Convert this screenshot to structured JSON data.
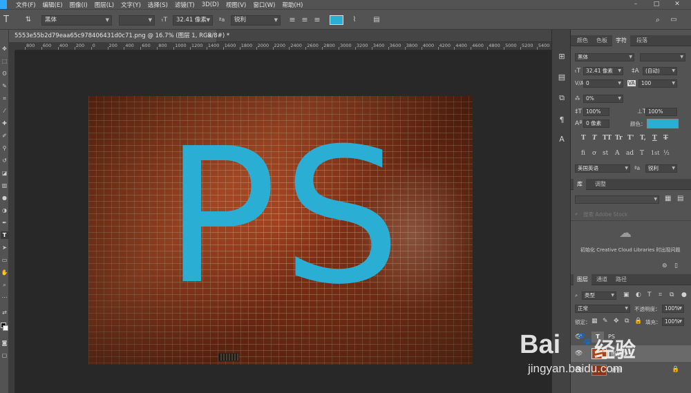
{
  "menu": {
    "items": [
      "文件(F)",
      "编辑(E)",
      "图像(I)",
      "图层(L)",
      "文字(Y)",
      "选择(S)",
      "滤镜(T)",
      "3D(D)",
      "视图(V)",
      "窗口(W)",
      "帮助(H)"
    ],
    "window_min": "–",
    "window_max": "□",
    "window_close": "✕"
  },
  "options": {
    "tool_glyph": "T",
    "font_family": "黑体",
    "font_style": "",
    "font_size": "32.41 像素",
    "aa_label": "ªa",
    "antialias": "锐利",
    "text_color": "#2aaed4"
  },
  "document": {
    "tab_title": "5553e55b2d79eaa65c978406431d0c71.png @ 16.7% (图层 1, RGB/8#) *",
    "tab_close": "×",
    "text_layer_content": "PS"
  },
  "ruler": {
    "labels": [
      "800",
      "600",
      "400",
      "200",
      "0",
      "200",
      "400",
      "600",
      "800",
      "1000",
      "1200",
      "1400",
      "1600",
      "1800",
      "2000",
      "2200",
      "2400",
      "2600",
      "2800",
      "3000",
      "3200",
      "3400",
      "3600",
      "3800",
      "4000",
      "4200",
      "4400",
      "4600",
      "4800",
      "5000",
      "5200",
      "5400"
    ]
  },
  "character_panel": {
    "tabs": [
      "颜色",
      "色板",
      "字符",
      "段落"
    ],
    "font_family": "黑体",
    "font_style": "",
    "font_size": "32.41 像素",
    "leading": "(自动)",
    "kerning": "0",
    "tracking": "100",
    "scale_percent": "0%",
    "vertical_scale": "100%",
    "horizontal_scale": "100%",
    "baseline_shift": "0 像素",
    "color_label": "颜色：",
    "color": "#2aaed4",
    "language": "美国英语",
    "aa_label": "ªa",
    "antialias": "锐利",
    "style_buttons": [
      "T",
      "T",
      "TT",
      "Tr",
      "T'",
      "T,",
      "T",
      "T"
    ],
    "opentype_buttons": [
      "fi",
      "ơ",
      "st",
      "A",
      "ad",
      "T",
      "1st",
      "½"
    ]
  },
  "library_panel": {
    "tabs": [
      "库",
      "调整"
    ],
    "search_placeholder": "搜索 Adobe Stock",
    "message": "初始化 Creative Cloud Libraries 时出现问题"
  },
  "layers_panel": {
    "tabs": [
      "图层",
      "通道",
      "路径"
    ],
    "filter_kind": "类型",
    "blend_mode": "正常",
    "opacity_label": "不透明度：",
    "opacity": "100%",
    "lock_label": "锁定：",
    "fill_label": "填充：",
    "fill": "100%",
    "layers": [
      {
        "name": "PS",
        "type": "text"
      },
      {
        "name": "图层 1",
        "type": "image"
      },
      {
        "name": "背景",
        "type": "background"
      }
    ]
  },
  "watermark": {
    "brand": "Bai",
    "brand_rest": "经验",
    "url": "jingyan.baidu.com"
  }
}
